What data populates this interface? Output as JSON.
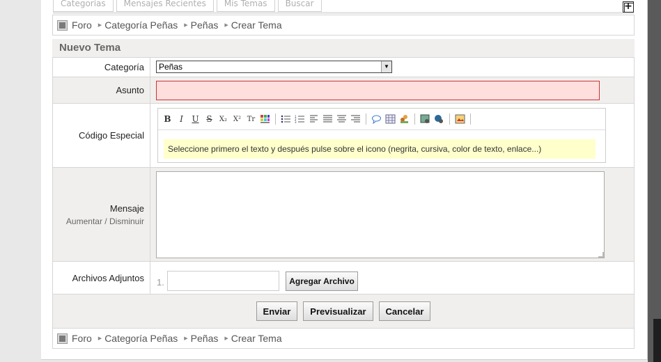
{
  "tabs": [
    "Categorías",
    "Mensajes Recientes",
    "Mis Temas",
    "Buscar"
  ],
  "breadcrumb": [
    "Foro",
    "Categoría Peñas",
    "Peñas",
    "Crear Tema"
  ],
  "section_title": "Nuevo Tema",
  "form": {
    "category_label": "Categoría",
    "category_value": "Peñas",
    "subject_label": "Asunto",
    "subject_value": "",
    "special_code_label": "Código Especial",
    "editor_hint": "Seleccione primero el texto y después pulse sobre el icono (negrita, cursiva, color de texto, enlace...)",
    "message_label": "Mensaje",
    "message_enlarge": "Aumentar",
    "message_divider": "/",
    "message_shrink": "Disminuir",
    "message_value": "",
    "attachments_label": "Archivos Adjuntos",
    "attachment_index": "1.",
    "add_file_button": "Agregar Archivo"
  },
  "toolbar_icons": {
    "bold": "B",
    "italic": "I",
    "underline": "U",
    "strike": "S",
    "subscript": "X₂",
    "superscript": "X²",
    "font_size": "Tr"
  },
  "actions": {
    "send": "Enviar",
    "preview": "Previsualizar",
    "cancel": "Cancelar"
  }
}
